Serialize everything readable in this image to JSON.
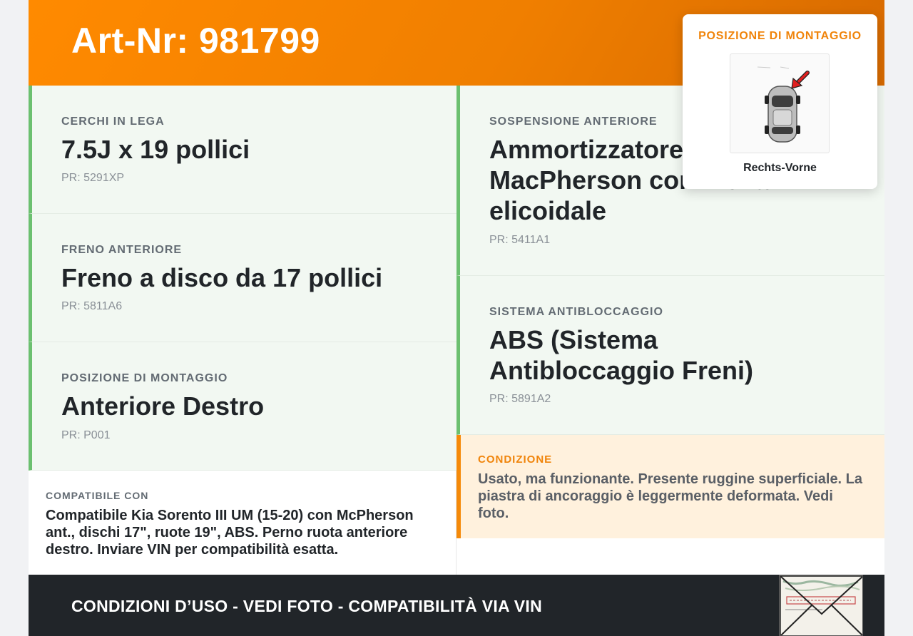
{
  "header": {
    "title": "Art-Nr: 981799"
  },
  "left_fields": [
    {
      "label": "CERCHI IN LEGA",
      "value": "7.5J x 19 pollici",
      "pr": "PR: 5291XP"
    },
    {
      "label": "FRENO ANTERIORE",
      "value": "Freno a disco da 17 pollici",
      "pr": "PR: 5811A6"
    },
    {
      "label": "POSIZIONE DI MONTAGGIO",
      "value": "Anteriore Destro",
      "pr": "PR: P001"
    }
  ],
  "right_fields": [
    {
      "label": "SOSPENSIONE ANTERIORE",
      "value_lines": [
        "Ammortizzatore",
        "MacPherson con molla",
        "elicoidale"
      ],
      "pr": "PR: 5411A1"
    },
    {
      "label": "SISTEMA ANTIBLOCCAGGIO",
      "value_lines": [
        "ABS (Sistema",
        "Antibloccaggio Freni)"
      ],
      "pr": "PR: 5891A2"
    }
  ],
  "compat": {
    "label": "COMPATIBILE CON",
    "text": "Compatibile Kia Sorento III UM (15-20) con McPherson ant., dischi 17\", ruote 19\", ABS. Perno ruota anteriore destro. Inviare VIN per compatibilità esatta."
  },
  "condition": {
    "label": "CONDIZIONE",
    "text": "Usato, ma funzionante. Presente ruggine superficiale. La piastra di ancoraggio è leggermente deformata. Vedi foto."
  },
  "footer": {
    "text": "CONDIZIONI D’USO - VEDI FOTO - COMPATIBILITÀ VIA VIN"
  },
  "popup": {
    "title": "POSIZIONE DI MONTAGGIO",
    "caption": "Rechts-Vorne"
  },
  "colors": {
    "accent": "#f58a0a",
    "green_border": "#6cc070",
    "footer_bg": "#212529"
  }
}
